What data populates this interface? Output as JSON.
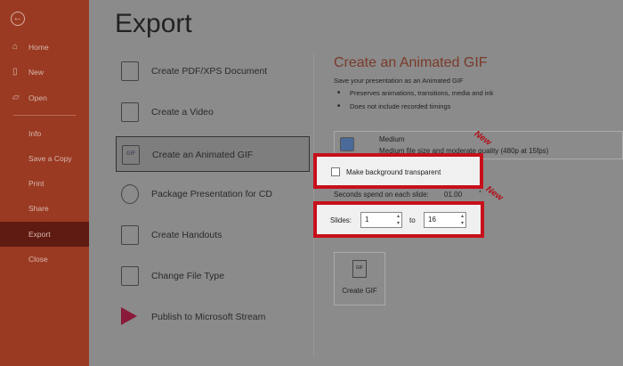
{
  "sidebar": {
    "items": [
      {
        "label": "Home",
        "icon": "home-icon"
      },
      {
        "label": "New",
        "icon": "new-icon"
      },
      {
        "label": "Open",
        "icon": "open-icon"
      },
      {
        "label": "Info"
      },
      {
        "label": "Save a Copy"
      },
      {
        "label": "Print"
      },
      {
        "label": "Share"
      },
      {
        "label": "Export"
      },
      {
        "label": "Close"
      }
    ]
  },
  "title": "Export",
  "options": [
    "Create PDF/XPS Document",
    "Create a Video",
    "Create an Animated GIF",
    "Package Presentation for CD",
    "Create Handouts",
    "Change File Type",
    "Publish to Microsoft Stream"
  ],
  "panel": {
    "title": "Create an Animated GIF",
    "subtitle": "Save your presentation as an Animated GIF",
    "bullets": [
      "Preserves animations, transitions, media and ink",
      "Does not include recorded timings"
    ],
    "quality": {
      "name": "Medium",
      "desc": "Medium file size and moderate quality (480p at 15fps)"
    },
    "transparent_label": "Make background transparent",
    "transparent_checked": false,
    "seconds_label": "Seconds spend on each slide:",
    "seconds_value": "01.00",
    "slides_label": "Slides:",
    "slides_from": "1",
    "to_label": "to",
    "slides_to": "16",
    "create_label": "Create GIF",
    "gif_icon_text": "GIF"
  },
  "annotations": {
    "new1": "New",
    "new2": "New"
  },
  "colors": {
    "sidebar": "#9a3a22",
    "highlight": "#c8101a"
  }
}
